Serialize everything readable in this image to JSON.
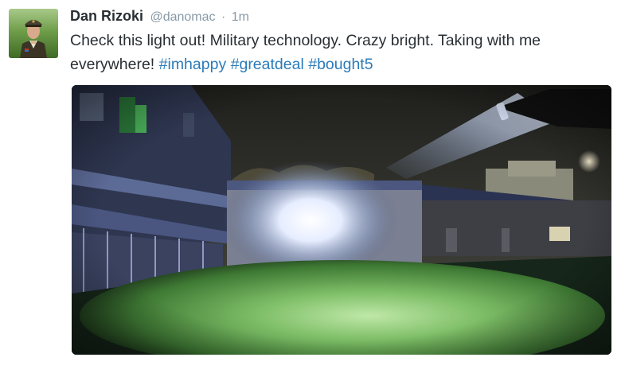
{
  "tweet": {
    "fullname": "Dan Rizoki",
    "handle": "@danomac",
    "separator": "·",
    "time": "1m",
    "text_main": "Check this light out! Military technology. Crazy bright. Taking with me everywhere!",
    "hashtags": [
      "#imhappy",
      "#greatdeal",
      "#bought5"
    ]
  },
  "avatar": {
    "icon": "profile-photo-soldier"
  },
  "media": {
    "icon": "photo-flashlight-night-scene"
  }
}
